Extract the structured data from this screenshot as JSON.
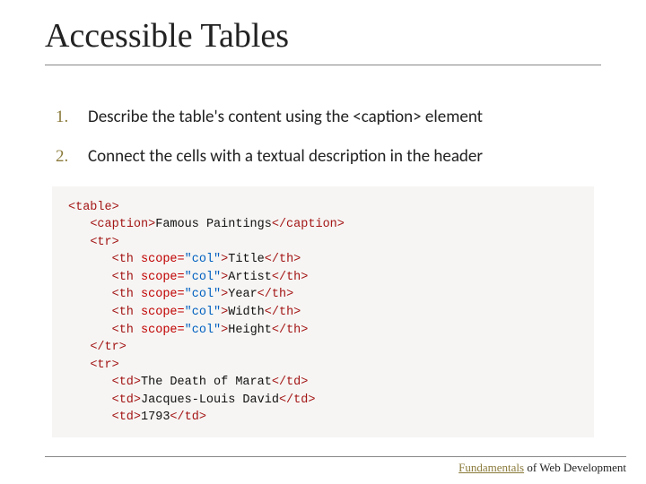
{
  "title": "Accessible Tables",
  "items": [
    "Describe the table's content using the <caption> element",
    "Connect the cells with a textual description in the header"
  ],
  "code": {
    "caption_text": "Famous Paintings",
    "scope_val": "\"col\"",
    "headers": [
      "Title",
      "Artist",
      "Year",
      "Width",
      "Height"
    ],
    "cells": [
      "The Death of Marat",
      "Jacques-Louis David",
      "1793"
    ]
  },
  "footer": {
    "accent": "Fundamentals",
    "rest": " of Web Development"
  }
}
